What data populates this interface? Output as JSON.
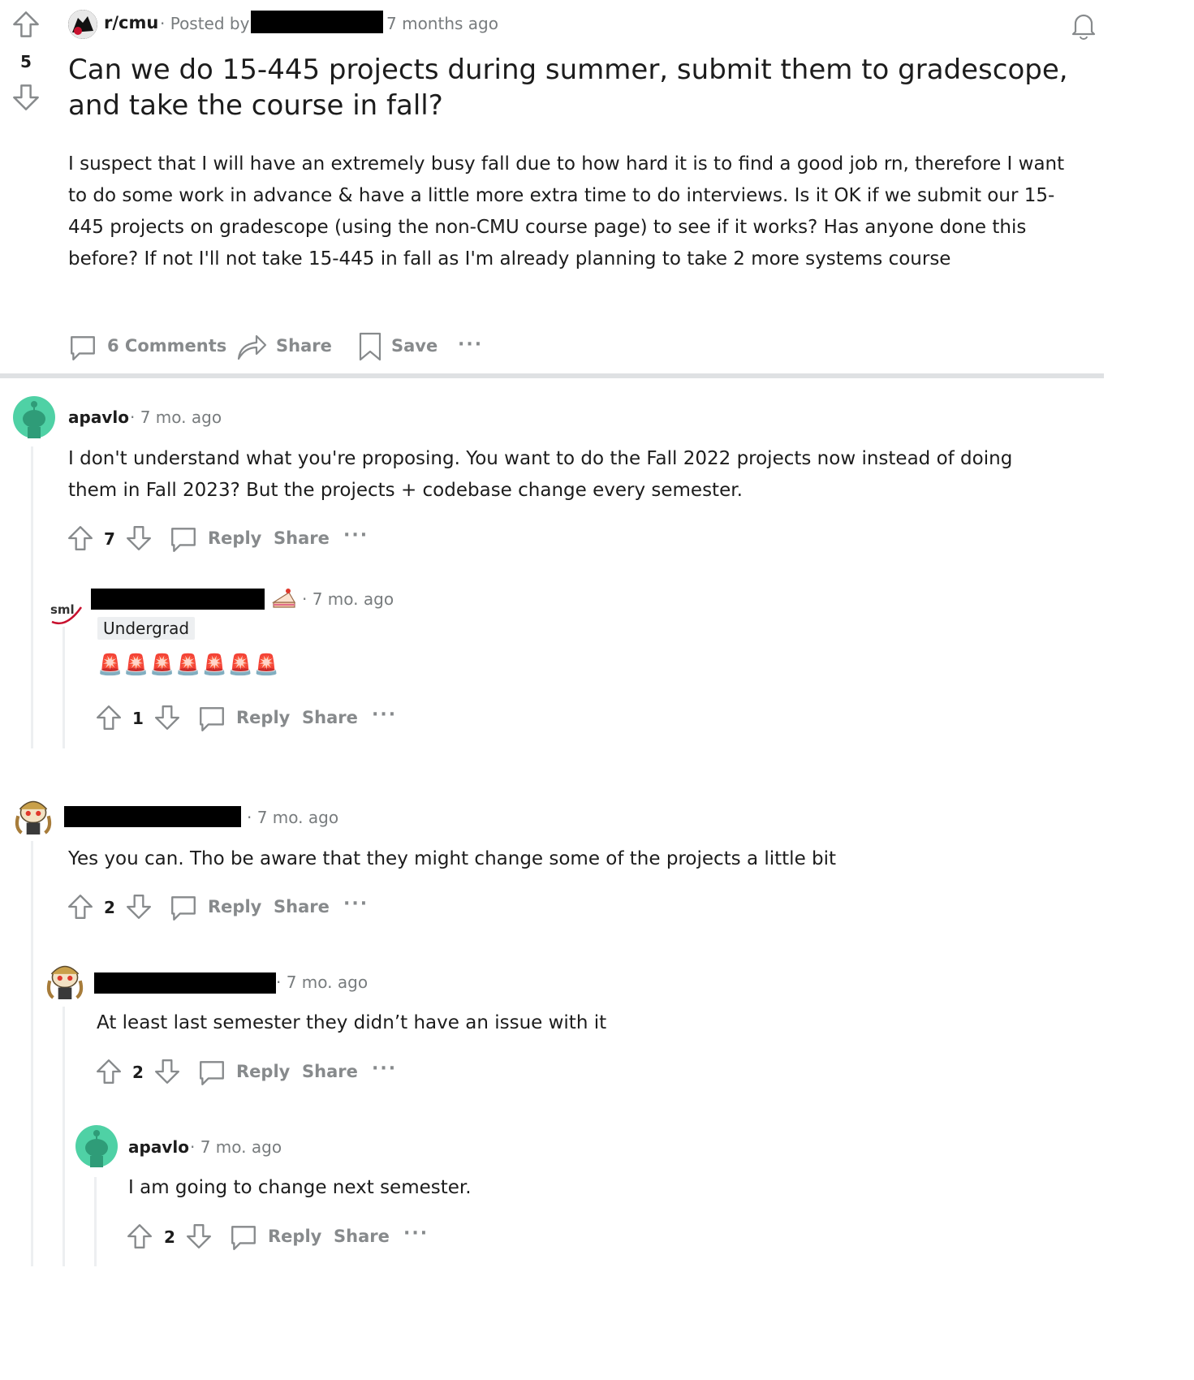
{
  "post": {
    "subreddit": "r/cmu",
    "posted_by": "· Posted by",
    "time": "7 months ago",
    "score": "5",
    "title": "Can we do 15-445 projects during summer, submit them to gradescope, and take the course in fall?",
    "body": "I suspect that I will have an extremely busy fall due to how hard it is to find a good job rn, therefore I want to do some work in advance & have a little more extra time to do interviews. Is it OK if we submit our 15-445 projects on gradescope (using the non-CMU course page) to see if it works? Has anyone done this before? If not I'll not take 15-445 in fall as I'm already planning to take 2 more systems course",
    "actions": {
      "comments": "6 Comments",
      "share": "Share",
      "save": "Save",
      "more": "···"
    }
  },
  "comments": [
    {
      "author": "apavlo",
      "time": "· 7 mo. ago",
      "text": "I don't understand what you're proposing. You want to do the Fall 2022 projects now instead of doing them in Fall 2023? But the projects + codebase change every semester.",
      "score": "7",
      "reply": "Reply",
      "share": "Share",
      "more": "···"
    },
    {
      "author": "",
      "flair": "Undergrad",
      "avatar_text": "sml",
      "time": "· 7 mo. ago",
      "text": "🚨🚨🚨🚨🚨🚨🚨",
      "score": "1",
      "reply": "Reply",
      "share": "Share",
      "more": "···"
    },
    {
      "author": "",
      "time": "· 7 mo. ago",
      "text": "Yes you can. Tho be aware that they might change some of the projects a little bit",
      "score": "2",
      "reply": "Reply",
      "share": "Share",
      "more": "···"
    },
    {
      "author": "",
      "time": "· 7 mo. ago",
      "text": "At least last semester they didn’t have an issue with it",
      "score": "2",
      "reply": "Reply",
      "share": "Share",
      "more": "···"
    },
    {
      "author": "apavlo",
      "time": "· 7 mo. ago",
      "text": "I am going to change next semester.",
      "score": "2",
      "reply": "Reply",
      "share": "Share",
      "more": "···"
    }
  ],
  "colors": {
    "muted": "#787c7e",
    "action": "#878a8c",
    "divider": "#dfe1e3",
    "avatar_green": "#4fd1a5"
  }
}
